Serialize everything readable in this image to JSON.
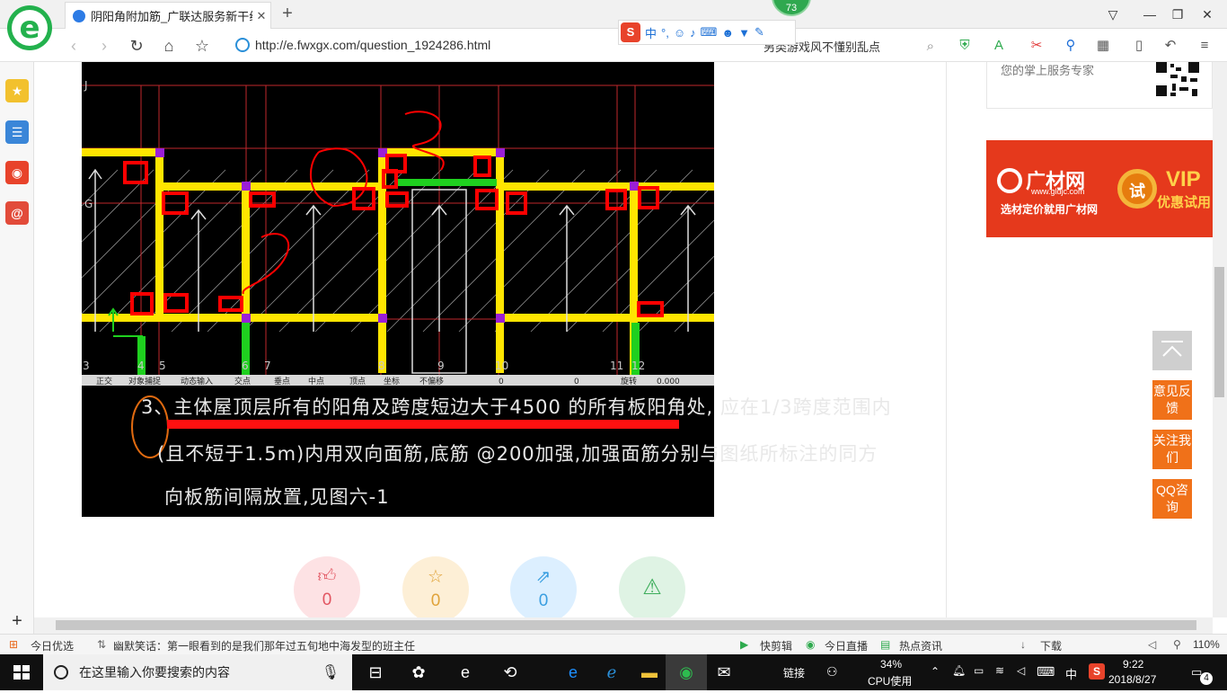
{
  "browser": {
    "tab_title": "阴阳角附加筋_广联达服务新干线",
    "tab_close": "✕",
    "new_tab": "+",
    "badge_count": "73",
    "url": "http://e.fwxgx.com/question_1924286.html",
    "search_text": "另类游戏风不懂别乱点",
    "ime_items": [
      "中",
      "°,",
      "☺",
      "♪"
    ],
    "window_buttons": [
      "⌂",
      "—",
      "❐",
      "✕"
    ]
  },
  "page": {
    "cad_labels": {
      "row_letter_top": "J",
      "row_letter_mid": "G",
      "axis_numbers": [
        "3",
        "4",
        "5",
        "6",
        "7",
        "8",
        "9",
        "10",
        "11",
        "12"
      ],
      "toolbar_items": [
        "正交",
        "对象捕捉",
        "动态输入",
        "交点",
        "垂点",
        "中点",
        "顶点",
        "坐标",
        "不偏移",
        "0",
        "0",
        "旋转",
        "0.000"
      ]
    },
    "note_lines": [
      "3、主体屋顶层所有的阳角及跨度短边大于4500 的所有板阳角处, 应在1/3跨度范围内",
      "(且不短于1.5m)内用双向面筋,底筋 @200加强,加强面筋分别与图纸所标注的同方",
      "向板筋间隔放置,见图六-1"
    ],
    "actions": [
      {
        "icon": "thumbs-up",
        "count": "0",
        "color": "#e25561",
        "bg": "#fde2e4"
      },
      {
        "icon": "star",
        "count": "0",
        "color": "#e0a33a",
        "bg": "#fdefd6"
      },
      {
        "icon": "share",
        "count": "0",
        "color": "#3a9ee0",
        "bg": "#dcefff"
      },
      {
        "icon": "warning",
        "count": "",
        "color": "#3fae5d",
        "bg": "#dff3e4"
      }
    ],
    "qr_text": "您的掌上服务专家",
    "vip_ad": {
      "brand": "广材网",
      "site": "www.gldjc.com",
      "slogan": "选材定价就用广材网",
      "try": "试",
      "vip": "VIP",
      "vip_sub": "优惠试用"
    },
    "float_buttons": [
      "意见反馈",
      "关注我们",
      "QQ咨询"
    ]
  },
  "statusbar": {
    "left": "今日优选",
    "news": "幽默笑话：第一眼看到的是我们那年过五旬地中海发型的班主任",
    "items": [
      "快剪辑",
      "今日直播",
      "热点资讯",
      "下载"
    ],
    "zoom": "110%"
  },
  "taskbar": {
    "search_placeholder": "在这里输入你要搜索的内容",
    "link_label": "链接",
    "cpu_percent": "34%",
    "cpu_label": "CPU使用",
    "ime": "中",
    "time": "9:22",
    "date": "2018/8/27",
    "notifications": "4"
  }
}
